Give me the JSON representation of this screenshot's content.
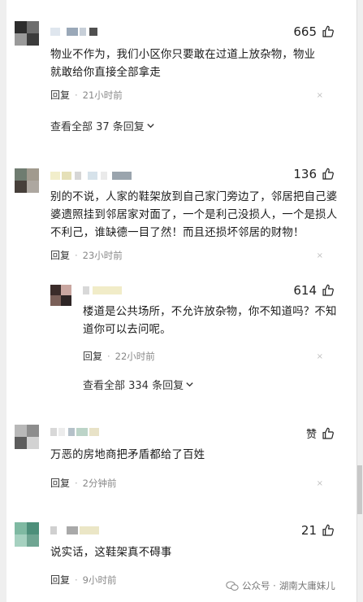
{
  "comments": [
    {
      "likes": "665",
      "text": "物业不作为，我们小区你只要敢在过道上放杂物，物业就敢给你直接全部拿走",
      "reply": "回复",
      "time": "21小时前",
      "view_more": "查看全部 37 条回复"
    },
    {
      "likes": "136",
      "text": "别的不说，人家的鞋架放到自己家门旁边了，邻居把自己婆婆遗照挂到邻居家对面了，一个是利己没损人，一个是损人不利己，谁缺德一目了然！而且还损坏邻居的财物！",
      "reply": "回复",
      "time": "23小时前"
    },
    {
      "likes": "614",
      "text": "楼道是公共场所，不允许放杂物，你不知道吗？不知道你可以去问呢。",
      "reply": "回复",
      "time": "22小时前",
      "view_more": "查看全部 334 条回复"
    },
    {
      "likes": "赞",
      "text": "万恶的房地商把矛盾都给了百姓",
      "reply": "回复",
      "time": "2分钟前"
    },
    {
      "likes": "21",
      "text": "说实话，这鞋架真不碍事",
      "reply": "回复",
      "time": "9小时前"
    }
  ],
  "dot": "·",
  "close_glyph": "×",
  "watermark": {
    "prefix": "公众号 · ",
    "account": "湖南大庸妹儿"
  },
  "icons": [
    "thumbs-up-icon",
    "close-icon",
    "chevron-down-icon",
    "wechat-icon"
  ]
}
